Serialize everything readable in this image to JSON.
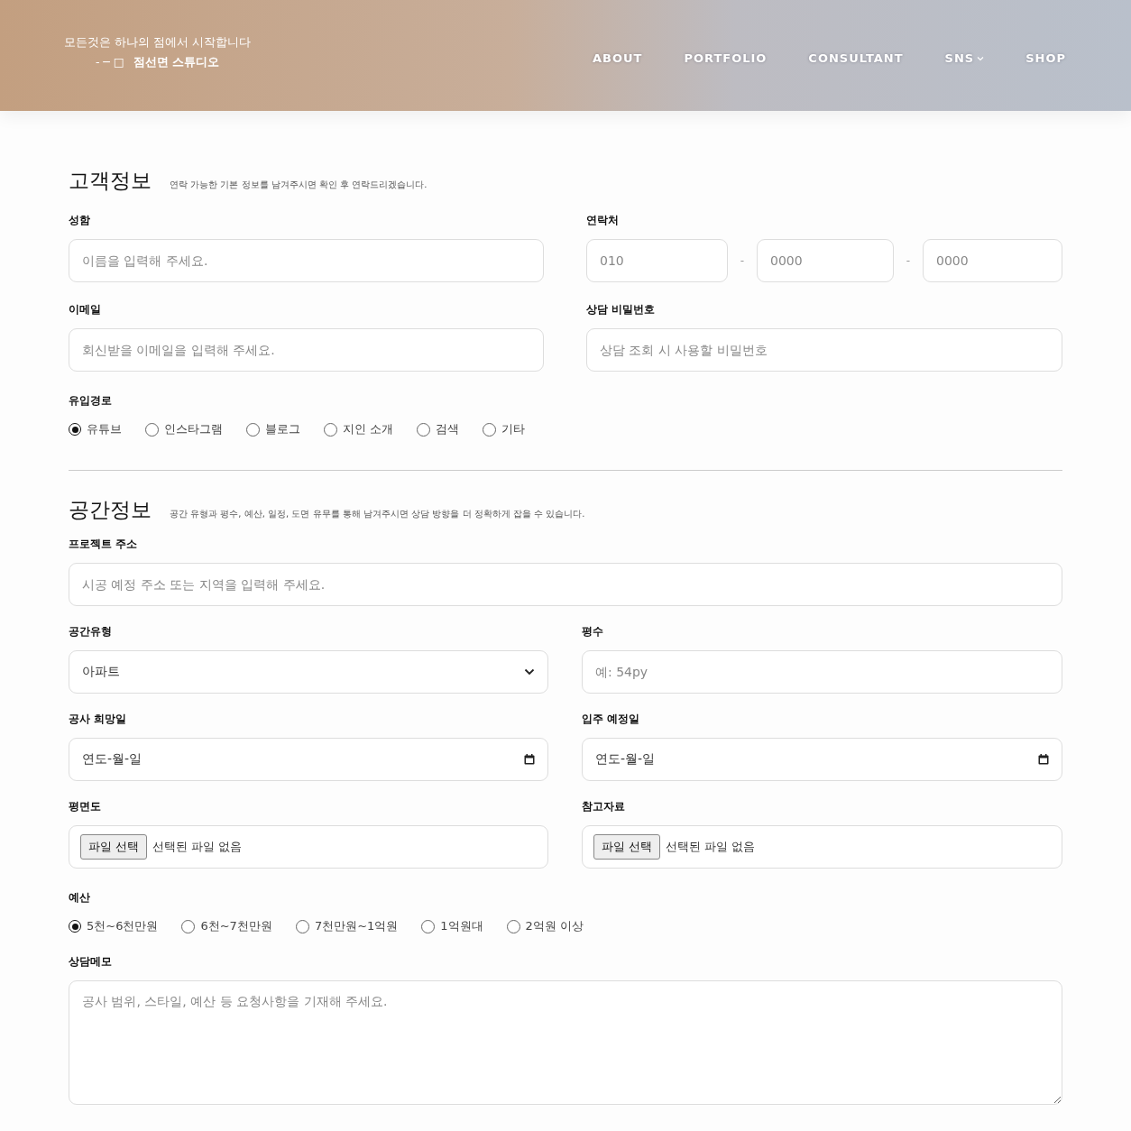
{
  "header": {
    "tagline": "모든것은 하나의 점에서 시작합니다",
    "logo_marks": "- ─ □",
    "logo_name": "점선면 스튜디오",
    "nav": [
      {
        "label": "ABOUT",
        "dropdown": false
      },
      {
        "label": "PORTFOLIO",
        "dropdown": false
      },
      {
        "label": "CONSULTANT",
        "dropdown": false
      },
      {
        "label": "SNS",
        "dropdown": true
      },
      {
        "label": "SHOP",
        "dropdown": false
      }
    ]
  },
  "customer_section": {
    "title": "고객정보",
    "description": "연락 가능한 기본 정보를 남겨주시면 확인 후 연락드리겠습니다.",
    "name": {
      "label": "성함",
      "placeholder": "이름을 입력해 주세요."
    },
    "phone": {
      "label": "연락처",
      "separator": "-",
      "parts": [
        {
          "placeholder": "010"
        },
        {
          "placeholder": "0000"
        },
        {
          "placeholder": "0000"
        }
      ]
    },
    "email": {
      "label": "이메일",
      "placeholder": "회신받을 이메일을 입력해 주세요."
    },
    "password": {
      "label": "상담 비밀번호",
      "placeholder": "상담 조회 시 사용할 비밀번호"
    },
    "referral": {
      "label": "유입경로",
      "options": [
        {
          "label": "유튜브",
          "selected": true
        },
        {
          "label": "인스타그램",
          "selected": false
        },
        {
          "label": "블로그",
          "selected": false
        },
        {
          "label": "지인 소개",
          "selected": false
        },
        {
          "label": "검색",
          "selected": false
        },
        {
          "label": "기타",
          "selected": false
        }
      ]
    }
  },
  "space_section": {
    "title": "공간정보",
    "description": "공간 유형과 평수, 예산, 일정, 도면 유무를 통해 남겨주시면 상담 방향을 더 정확하게 잡을 수 있습니다.",
    "address": {
      "label": "프로젝트 주소",
      "placeholder": "시공 예정 주소 또는 지역을 입력해 주세요."
    },
    "space_type": {
      "label": "공간유형",
      "value": "아파트"
    },
    "area": {
      "label": "평수",
      "placeholder": "예: 54py"
    },
    "construction_date": {
      "label": "공사 희망일",
      "value": "연도-월-일"
    },
    "move_in_date": {
      "label": "입주 예정일",
      "value": "연도-월-일"
    },
    "floor_plan": {
      "label": "평면도",
      "button": "파일 선택",
      "status": "선택된 파일 없음"
    },
    "reference": {
      "label": "참고자료",
      "button": "파일 선택",
      "status": "선택된 파일 없음"
    },
    "budget": {
      "label": "예산",
      "options": [
        {
          "label": "5천~6천만원",
          "selected": true
        },
        {
          "label": "6천~7천만원",
          "selected": false
        },
        {
          "label": "7천만원~1억원",
          "selected": false
        },
        {
          "label": "1억원대",
          "selected": false
        },
        {
          "label": "2억원 이상",
          "selected": false
        }
      ]
    },
    "memo": {
      "label": "상담메모",
      "placeholder": "공사 범위, 스타일, 예산 등 요청사항을 기재해 주세요."
    }
  }
}
